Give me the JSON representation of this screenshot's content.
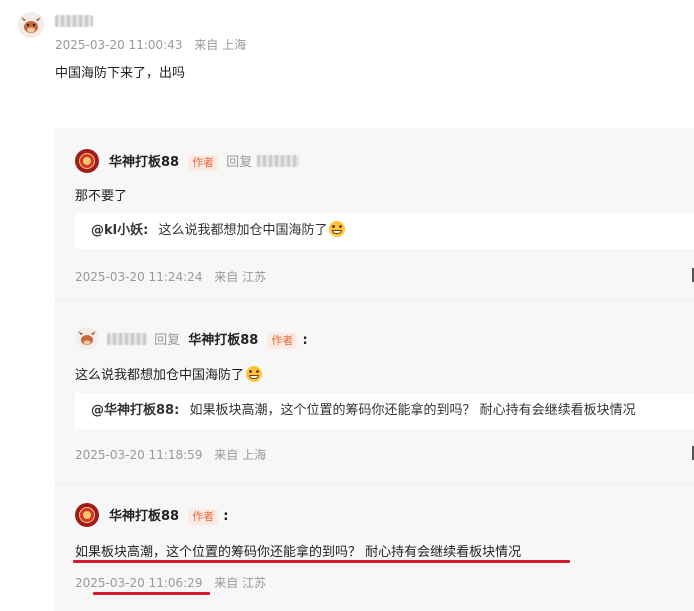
{
  "top_comment": {
    "timestamp": "2025-03-20 11:00:43",
    "location": "来自 上海",
    "text": "中国海防下来了，出吗"
  },
  "replies": [
    {
      "author": "华神打板88",
      "author_tag": "作者",
      "reply_word": "回复",
      "text": "那不要了",
      "quote_author": "@kl小妖:",
      "quote_text": "这么说我都想加仓中国海防了",
      "timestamp": "2025-03-20 11:24:24",
      "location": "来自 江苏"
    },
    {
      "reply_word": "回复",
      "reply_target": "华神打板88",
      "reply_target_tag": "作者",
      "colon": ":",
      "text": "这么说我都想加仓中国海防了",
      "quote_author": "@华神打板88:",
      "quote_text": "如果板块高潮，这个位置的筹码你还能拿的到吗？ 耐心持有会继续看板块情况",
      "timestamp": "2025-03-20 11:18:59",
      "location": "来自 上海"
    },
    {
      "author": "华神打板88",
      "author_tag": "作者",
      "colon": ":",
      "text": "如果板块高潮，这个位置的筹码你还能拿的到吗？ 耐心持有会继续看板块情况",
      "timestamp": "2025-03-20 11:06:29",
      "location": "来自 江苏"
    }
  ],
  "icons": {
    "emoji": "grinning-face-icon",
    "user_avatar": "cow-avatar-icon",
    "author_avatar": "red-logo-avatar-icon"
  },
  "colors": {
    "author_tag_text": "#e66a3a",
    "author_tag_bg": "#fdebe3",
    "underline": "#d8192a",
    "thread_bg": "#f7f7f8"
  }
}
